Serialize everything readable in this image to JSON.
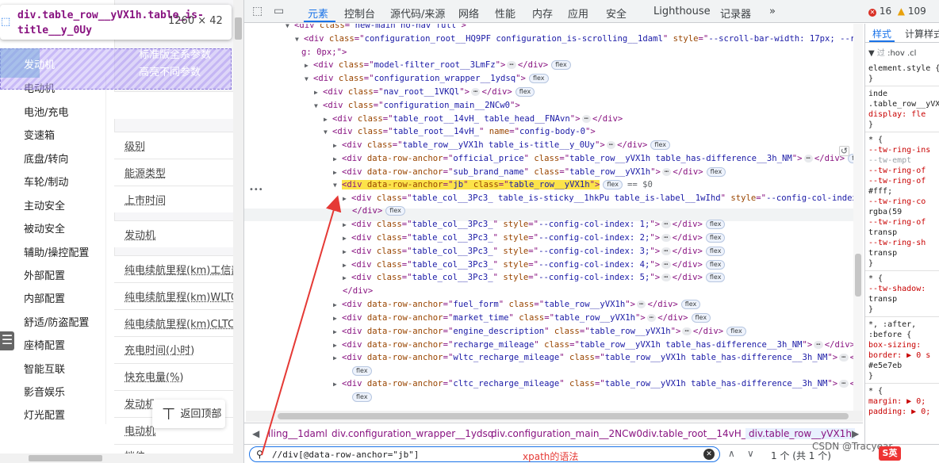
{
  "left_page": {
    "tooltip": {
      "selector": "div.table_row__yVX1h.table_is-title__y_0Uy",
      "dimensions": "1260 × 42"
    },
    "highlight_text": [
      "标准版全系参数",
      "高亮不同参数"
    ],
    "sidebar_top": "发动机",
    "sidebar": [
      "电动机",
      "电池/充电",
      "变速箱",
      "底盘/转向",
      "车轮/制动",
      "主动安全",
      "被动安全",
      "辅助/操控配置",
      "外部配置",
      "内部配置",
      "舒适/防盗配置",
      "座椅配置",
      "智能互联",
      "影音娱乐",
      "灯光配置"
    ],
    "params": [
      "级别",
      "能源类型",
      "上市时间",
      "发动机",
      "纯电续航里程(km)工信部",
      "纯电续航里程(km)WLTC",
      "纯电续航里程(km)CLTC",
      "充电时间(小时)",
      "快充电量(%)",
      "发动机",
      "电动机",
      "挡位"
    ],
    "back_to_top": "返回顶部",
    "menu_icon": "☰"
  },
  "devtools": {
    "tabs": [
      "元素",
      "控制台",
      "源代码/来源",
      "网络",
      "性能",
      "内存",
      "应用",
      "安全",
      "Lighthouse",
      "记录器"
    ],
    "errors": "16",
    "warnings": "109",
    "more_tabs": "»",
    "tree": [
      {
        "t": "expanded",
        "i": 0,
        "tag": "div",
        "attrs": [
          [
            "class",
            "new-main  no-nav full"
          ]
        ],
        "tail": ""
      },
      {
        "t": "expanded",
        "i": 1,
        "tag": "div",
        "attrs": [
          [
            "class",
            "configuration_root__HQ9PF configuration_is-scrolling__1daml"
          ],
          [
            "style",
            "--scroll-bar-width: 17px; --root-paddin"
          ]
        ],
        "tail": ""
      },
      {
        "t": "cont",
        "i": 1,
        "text": "g: 0px;\">"
      },
      {
        "t": "collapsed",
        "i": 2,
        "tag": "div",
        "attrs": [
          [
            "class",
            "model-filter_root__3LmFz"
          ]
        ],
        "tail": "</div>",
        "badge": "flex"
      },
      {
        "t": "expanded",
        "i": 2,
        "tag": "div",
        "attrs": [
          [
            "class",
            "configuration_wrapper__1ydsq"
          ]
        ],
        "tail": "",
        "badge": "flex"
      },
      {
        "t": "collapsed",
        "i": 3,
        "tag": "div",
        "attrs": [
          [
            "class",
            "nav_root__1VKQl"
          ]
        ],
        "tail": "</div>",
        "badge": "flex"
      },
      {
        "t": "expanded",
        "i": 3,
        "tag": "div",
        "attrs": [
          [
            "class",
            "configuration_main__2NCw0"
          ]
        ],
        "tail": ""
      },
      {
        "t": "collapsed",
        "i": 4,
        "tag": "div",
        "attrs": [
          [
            "class",
            "table_root__14vH_ table_head__FNAvn"
          ]
        ],
        "tail": "</div>"
      },
      {
        "t": "expanded",
        "i": 4,
        "tag": "div",
        "attrs": [
          [
            "class",
            "table_root__14vH_"
          ],
          [
            "name",
            "config-body-0"
          ]
        ],
        "tail": ""
      },
      {
        "t": "collapsed",
        "i": 5,
        "tag": "div",
        "attrs": [
          [
            "class",
            "table_row__yVX1h table_is-title__y_0Uy"
          ]
        ],
        "tail": "</div>",
        "badge": "flex"
      },
      {
        "t": "collapsed",
        "i": 5,
        "tag": "div",
        "attrs": [
          [
            "data-row-anchor",
            "official_price"
          ],
          [
            "class",
            "table_row__yVX1h table_has-difference__3h_NM"
          ]
        ],
        "tail": "</div>",
        "badge": "flex"
      },
      {
        "t": "collapsed",
        "i": 5,
        "tag": "div",
        "attrs": [
          [
            "data-row-anchor",
            "sub_brand_name"
          ],
          [
            "class",
            "table_row__yVX1h"
          ]
        ],
        "tail": "</div>",
        "badge": "flex"
      },
      {
        "t": "selected",
        "i": 5,
        "tag": "div",
        "attrs": [
          [
            "data-row-anchor",
            "jb"
          ],
          [
            "class",
            "table_row__yVX1h"
          ]
        ],
        "badge": "flex",
        "suffix": "== $0"
      },
      {
        "t": "collapsed",
        "i": 6,
        "tag": "div",
        "attrs": [
          [
            "class",
            "table_col__3Pc3_ table_is-sticky__1hkPu table_is-label__1wIhd"
          ],
          [
            "style",
            "--config-col-index: 0;"
          ]
        ],
        "tail": ""
      },
      {
        "t": "close",
        "i": 6,
        "text": "</div>",
        "badge": "flex"
      },
      {
        "t": "collapsed",
        "i": 6,
        "tag": "div",
        "attrs": [
          [
            "class",
            "table_col__3Pc3_"
          ],
          [
            "style",
            "--config-col-index: 1;"
          ]
        ],
        "tail": "</div>",
        "badge": "flex"
      },
      {
        "t": "collapsed",
        "i": 6,
        "tag": "div",
        "attrs": [
          [
            "class",
            "table_col__3Pc3_"
          ],
          [
            "style",
            "--config-col-index: 2;"
          ]
        ],
        "tail": "</div>",
        "badge": "flex"
      },
      {
        "t": "collapsed",
        "i": 6,
        "tag": "div",
        "attrs": [
          [
            "class",
            "table_col__3Pc3_"
          ],
          [
            "style",
            "--config-col-index: 3;"
          ]
        ],
        "tail": "</div>",
        "badge": "flex"
      },
      {
        "t": "collapsed",
        "i": 6,
        "tag": "div",
        "attrs": [
          [
            "class",
            "table_col__3Pc3_"
          ],
          [
            "style",
            "--config-col-index: 4;"
          ]
        ],
        "tail": "</div>",
        "badge": "flex"
      },
      {
        "t": "collapsed",
        "i": 6,
        "tag": "div",
        "attrs": [
          [
            "class",
            "table_col__3Pc3_"
          ],
          [
            "style",
            "--config-col-index: 5;"
          ]
        ],
        "tail": "</div>",
        "badge": "flex"
      },
      {
        "t": "close",
        "i": 5,
        "text": "</div>"
      },
      {
        "t": "collapsed",
        "i": 5,
        "tag": "div",
        "attrs": [
          [
            "data-row-anchor",
            "fuel_form"
          ],
          [
            "class",
            "table_row__yVX1h"
          ]
        ],
        "tail": "</div>",
        "badge": "flex"
      },
      {
        "t": "collapsed",
        "i": 5,
        "tag": "div",
        "attrs": [
          [
            "data-row-anchor",
            "market_time"
          ],
          [
            "class",
            "table_row__yVX1h"
          ]
        ],
        "tail": "</div>",
        "badge": "flex"
      },
      {
        "t": "collapsed",
        "i": 5,
        "tag": "div",
        "attrs": [
          [
            "data-row-anchor",
            "engine_description"
          ],
          [
            "class",
            "table_row__yVX1h"
          ]
        ],
        "tail": "</div>",
        "badge": "flex"
      },
      {
        "t": "collapsed",
        "i": 5,
        "tag": "div",
        "attrs": [
          [
            "data-row-anchor",
            "recharge_mileage"
          ],
          [
            "class",
            "table_row__yVX1h table_has-difference__3h_NM"
          ]
        ],
        "tail": "</div>",
        "badge": "flex"
      },
      {
        "t": "collapsed",
        "i": 5,
        "tag": "div",
        "attrs": [
          [
            "data-row-anchor",
            "wltc_recharge_mileage"
          ],
          [
            "class",
            "table_row__yVX1h table_has-difference__3h_NM"
          ]
        ],
        "tail": "</div>"
      },
      {
        "t": "badgeonly",
        "i": 5,
        "badge": "flex"
      },
      {
        "t": "collapsed",
        "i": 5,
        "tag": "div",
        "attrs": [
          [
            "data-row-anchor",
            "cltc_recharge_mileage"
          ],
          [
            "class",
            "table_row__yVX1h table_has-difference__3h_NM"
          ]
        ],
        "tail": "</div>"
      },
      {
        "t": "badgeonly",
        "i": 5,
        "badge": "flex"
      }
    ],
    "breadcrumbs": [
      "lling__1daml",
      "div.configuration_wrapper__1ydsq",
      "div.configuration_main__2NCw0",
      "div.table_root__14vH_",
      "div.table_row__yVX1h"
    ],
    "search": {
      "value": "//div[@data-row-anchor=\"jb\"]",
      "hint": "xpath的语法",
      "result": "1 个 (共 1 个)"
    },
    "styles": {
      "tabs": [
        "样式",
        "计算样式"
      ],
      "filter": ":hov .cl",
      "lines": [
        {
          "c": "",
          "text": "element.style {"
        },
        {
          "c": "",
          "text": "}"
        },
        {
          "c": "sep"
        },
        {
          "c": "",
          "text": "         inde"
        },
        {
          "c": "",
          "text": ".table_row__yVX1"
        },
        {
          "c": "p",
          "text": "  display: fle"
        },
        {
          "c": "",
          "text": "}"
        },
        {
          "c": "sep"
        },
        {
          "c": "",
          "text": "* {"
        },
        {
          "c": "p",
          "text": "  --tw-ring-ins"
        },
        {
          "c": "g",
          "text": "    --tw-empt"
        },
        {
          "c": "p",
          "text": "  --tw-ring-of"
        },
        {
          "c": "p",
          "text": "  --tw-ring-of"
        },
        {
          "c": "",
          "text": "    #fff;"
        },
        {
          "c": "p",
          "text": "  --tw-ring-co"
        },
        {
          "c": "",
          "text": "    rgba(59"
        },
        {
          "c": "p",
          "text": "  --tw-ring-of"
        },
        {
          "c": "",
          "text": "    transp"
        },
        {
          "c": "p",
          "text": "  --tw-ring-sh"
        },
        {
          "c": "",
          "text": "    transp"
        },
        {
          "c": "",
          "text": "}"
        },
        {
          "c": "sep"
        },
        {
          "c": "",
          "text": "* {"
        },
        {
          "c": "p",
          "text": "  --tw-shadow:"
        },
        {
          "c": "",
          "text": "    transp"
        },
        {
          "c": "",
          "text": "}"
        },
        {
          "c": "sep"
        },
        {
          "c": "",
          "text": "*, :after,"
        },
        {
          "c": "",
          "text": ":before {"
        },
        {
          "c": "p",
          "text": "  box-sizing:"
        },
        {
          "c": "p",
          "text": "  border: ▶ 0 s"
        },
        {
          "c": "",
          "text": "    #e5e7eb"
        },
        {
          "c": "",
          "text": "}"
        },
        {
          "c": "sep"
        },
        {
          "c": "",
          "text": "* {"
        },
        {
          "c": "p",
          "text": "  margin: ▶ 0;"
        },
        {
          "c": "p",
          "text": "  padding: ▶ 0;"
        }
      ]
    }
  },
  "watermark": "CSDN @Tracyear",
  "csdn_logo": "S英",
  "colors": {
    "accent": "#1a73e8",
    "tag": "#881280",
    "attr_name": "#994500",
    "attr_value": "#1a1aa6",
    "selected": "#fce34a",
    "arrow": "#e53935"
  }
}
